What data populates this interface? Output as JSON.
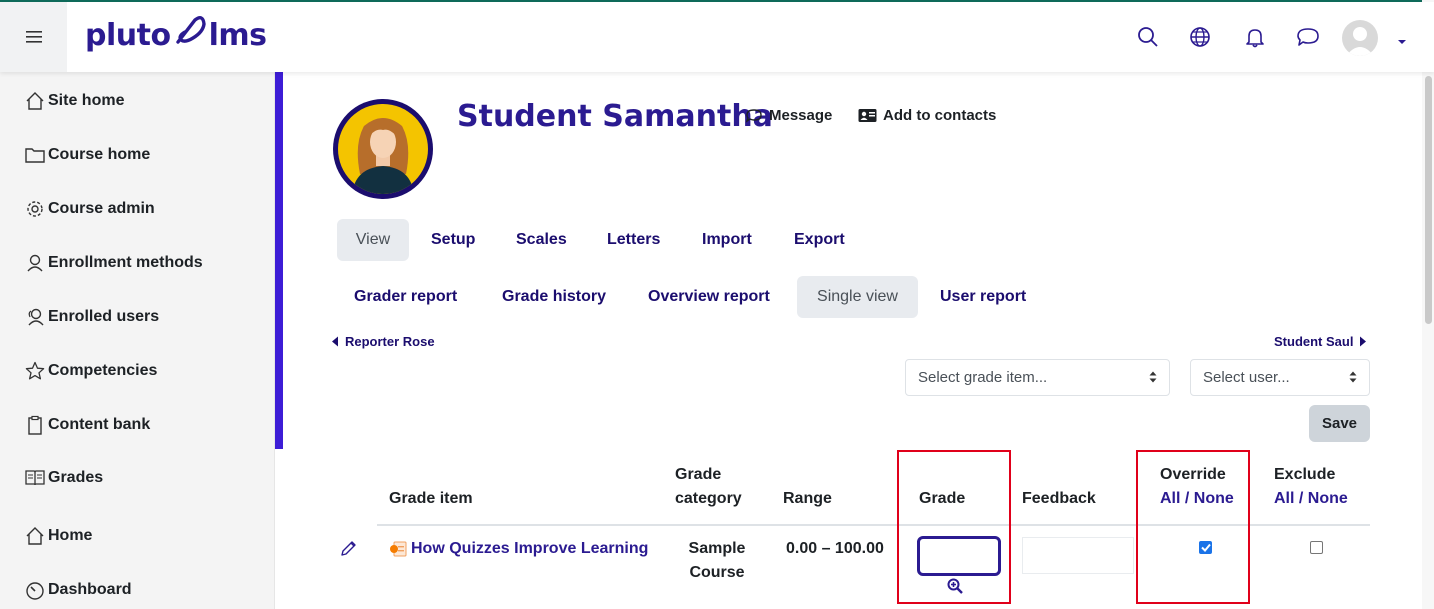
{
  "header": {
    "logo_left": "pluto",
    "logo_right": "lms",
    "icons": [
      "hamburger-icon",
      "search-icon",
      "globe-icon",
      "bell-icon",
      "chat-icon",
      "avatar",
      "caret-down-icon"
    ]
  },
  "sidebar": {
    "items": [
      {
        "label": "Site home",
        "icon": "home-icon"
      },
      {
        "label": "Course home",
        "icon": "folder-icon"
      },
      {
        "label": "Course admin",
        "icon": "gear-icon"
      },
      {
        "label": "Enrollment methods",
        "icon": "user-icon"
      },
      {
        "label": "Enrolled users",
        "icon": "users-icon"
      },
      {
        "label": "Competencies",
        "icon": "star-icon"
      },
      {
        "label": "Content bank",
        "icon": "clipboard-icon"
      },
      {
        "label": "Grades",
        "icon": "book-icon"
      },
      {
        "label": "Home",
        "icon": "home-icon"
      },
      {
        "label": "Dashboard",
        "icon": "gauge-icon"
      }
    ]
  },
  "profile": {
    "name": "Student Samantha",
    "message_label": "Message",
    "add_contacts_label": "Add to contacts"
  },
  "tabs_primary": [
    "View",
    "Setup",
    "Scales",
    "Letters",
    "Import",
    "Export"
  ],
  "tabs_secondary": [
    "Grader report",
    "Grade history",
    "Overview report",
    "Single view",
    "User report"
  ],
  "nav": {
    "prev_user": "Reporter Rose",
    "next_user": "Student Saul"
  },
  "selects": {
    "grade_item": "Select grade item...",
    "user": "Select user..."
  },
  "save_label": "Save",
  "table": {
    "headers": {
      "grade_item": "Grade item",
      "grade_category_1": "Grade",
      "grade_category_2": "category",
      "range": "Range",
      "grade": "Grade",
      "feedback": "Feedback",
      "override": "Override",
      "exclude": "Exclude",
      "all": "All",
      "sep": " / ",
      "none": "None"
    },
    "rows": [
      {
        "item": "How Quizzes Improve Learning",
        "category_1": "Sample",
        "category_2": "Course",
        "range": "0.00 – 100.00",
        "grade": "",
        "feedback": "",
        "override": true,
        "exclude": false
      }
    ]
  },
  "colors": {
    "brand": "#2b1b91",
    "accent": "#3d1dd6",
    "highlight": "#e0001a"
  }
}
